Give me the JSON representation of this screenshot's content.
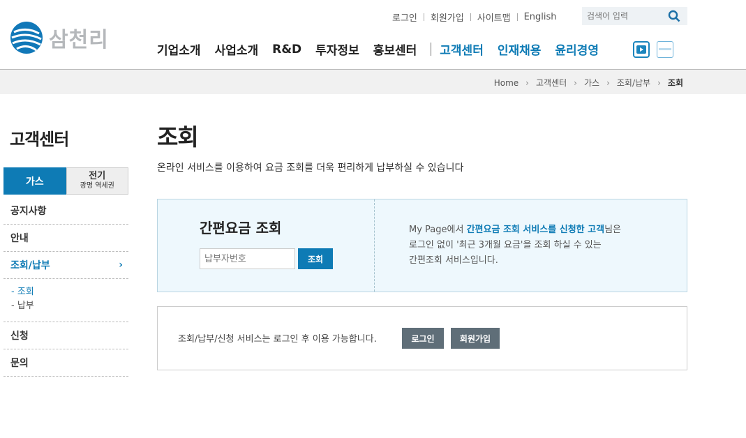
{
  "brand": {
    "name": "삼천리",
    "accent": "#0e7bb5"
  },
  "util_links": [
    "로그인",
    "회원가입",
    "사이트맵",
    "English"
  ],
  "search": {
    "placeholder": "검색어 입력"
  },
  "gnb": {
    "main": [
      "기업소개",
      "사업소개",
      "R&D",
      "투자정보",
      "홍보센터"
    ],
    "extra": [
      "고객센터",
      "인재채용",
      "윤리경영"
    ],
    "icons": [
      "youtube-icon",
      "sns-icon"
    ]
  },
  "breadcrumb": [
    "Home",
    "고객센터",
    "가스",
    "조회/납부",
    "조회"
  ],
  "lnb": {
    "title": "고객센터",
    "tab_gas": "가스",
    "tab_elec": "전기",
    "tab_elec_sub": "광명 역세권",
    "items": [
      "공지사항",
      "안내",
      "조회/납부",
      "신청",
      "문의"
    ],
    "sub": [
      "-  조회",
      "-  납부"
    ]
  },
  "content": {
    "title": "조회",
    "desc": "온라인 서비스를 이용하여 요금 조회를 더욱 편리하게 납부하실 수 있습니다",
    "quick": {
      "title": "간편요금 조회",
      "placeholder": "납부자번호",
      "button": "조회",
      "info_1a": "My Page에서 ",
      "info_1b": "간편요금 조회 서비스를 신청한 고객",
      "info_1c": "님은",
      "info_2": "로그인 없이 '최근 3개월 요금'을 조회 하실 수 있는",
      "info_3": "간편조회 서비스입니다."
    },
    "login_box": {
      "message": "조회/납부/신청 서비스는 로그인 후 이용 가능합니다.",
      "login": "로그인",
      "join": "회원가입"
    }
  }
}
